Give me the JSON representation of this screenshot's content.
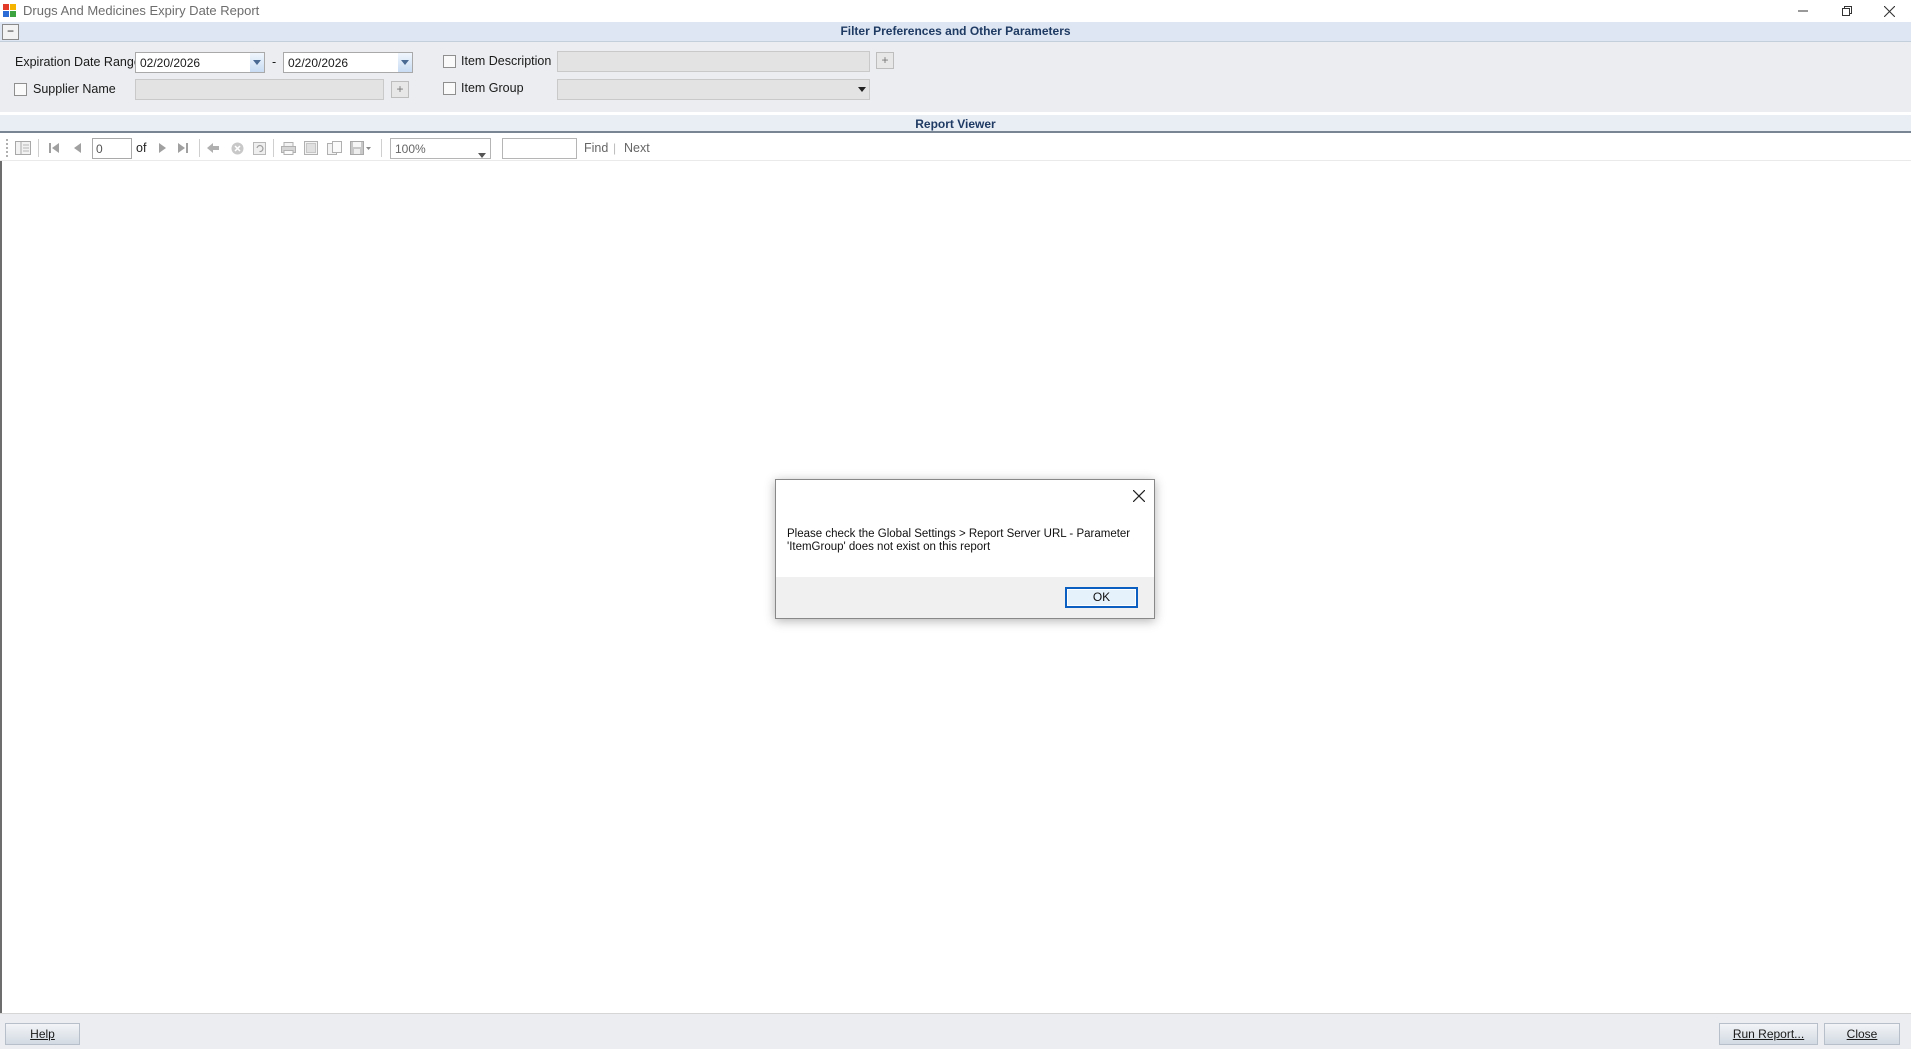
{
  "window": {
    "title": "Drugs And Medicines Expiry Date Report",
    "icons": {
      "app": "app-grid-icon",
      "minimize": "minimize-icon",
      "restore": "restore-icon",
      "close": "close-icon"
    }
  },
  "filter_panel": {
    "title": "Filter Preferences and Other Parameters",
    "collapse_label": "−",
    "expiration": {
      "label": "Expiration Date Range",
      "from": "02/20/2026",
      "separator": "-",
      "to": "02/20/2026"
    },
    "supplier": {
      "label": "Supplier Name",
      "value": "",
      "checked": false
    },
    "item_description": {
      "label": "Item Description",
      "value": "",
      "checked": false
    },
    "item_group": {
      "label": "Item Group",
      "value": "",
      "checked": false
    },
    "plus_label": "+"
  },
  "report_viewer": {
    "title": "Report Viewer",
    "toolbar": {
      "page_value": "0",
      "of_label": "of",
      "zoom_value": "100%",
      "find_label": "Find",
      "separator": "|",
      "next_label": "Next"
    }
  },
  "dialog": {
    "message": "Please check the Global Settings > Report Server URL - Parameter 'ItemGroup' does not exist on this report",
    "ok_label": "OK"
  },
  "footer": {
    "help_label": "Help",
    "run_label": "Run Report...",
    "close_label": "Close"
  },
  "colors": {
    "header_bg": "#dde6f2",
    "header_text": "#1f3a63",
    "panel_bg": "#ebedf0",
    "ok_border": "#0a5fc1"
  }
}
